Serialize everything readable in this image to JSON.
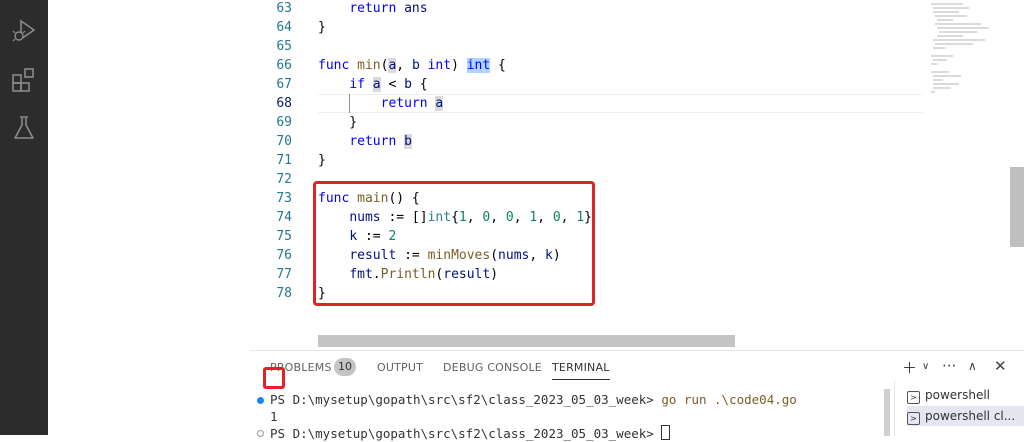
{
  "editor": {
    "lines": [
      {
        "n": "63",
        "code": "return ans"
      },
      {
        "n": "64",
        "code": "}"
      },
      {
        "n": "65",
        "code": ""
      },
      {
        "n": "66",
        "code": "func min(a, b int) int {"
      },
      {
        "n": "67",
        "code": "if a < b {"
      },
      {
        "n": "68",
        "code": "return a"
      },
      {
        "n": "69",
        "code": "}"
      },
      {
        "n": "70",
        "code": "return b"
      },
      {
        "n": "71",
        "code": "}"
      },
      {
        "n": "72",
        "code": ""
      },
      {
        "n": "73",
        "code": "func main() {"
      },
      {
        "n": "74",
        "code": "nums := []int{1, 0, 0, 1, 0, 1}"
      },
      {
        "n": "75",
        "code": "k := 2"
      },
      {
        "n": "76",
        "code": "result := minMoves(nums, k)"
      },
      {
        "n": "77",
        "code": "fmt.Println(result)"
      },
      {
        "n": "78",
        "code": "}"
      }
    ]
  },
  "panel": {
    "tabs": {
      "problems": "PROBLEMS",
      "problems_count": "10",
      "output": "OUTPUT",
      "debug_console": "DEBUG CONSOLE",
      "terminal": "TERMINAL"
    },
    "terminal": {
      "prompt1": "PS D:\\mysetup\\gopath\\src\\sf2\\class_2023_05_03_week>",
      "command": "go run .\\code04.go",
      "output": "1",
      "prompt2": "PS D:\\mysetup\\gopath\\src\\sf2\\class_2023_05_03_week>"
    },
    "terminal_list": [
      {
        "label": "powershell"
      },
      {
        "label": "powershell cl..."
      }
    ]
  },
  "icons": {
    "run_debug": "run-debug-icon",
    "extensions": "extensions-icon",
    "testing": "flask-icon"
  },
  "colors": {
    "keyword": "#0000ff",
    "function": "#795e26",
    "number": "#098658",
    "type": "#267f99",
    "line_number": "#237893",
    "highlight_box": "#e02424"
  }
}
